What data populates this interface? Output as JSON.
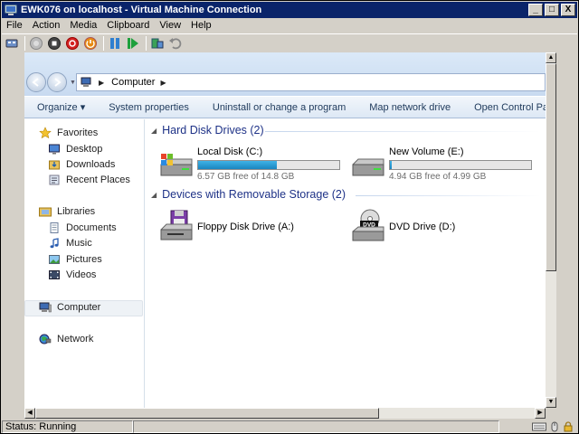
{
  "window": {
    "title": "EWK076 on localhost - Virtual Machine Connection",
    "controls": [
      "_",
      "□",
      "X"
    ]
  },
  "menu": [
    "File",
    "Action",
    "Media",
    "Clipboard",
    "View",
    "Help"
  ],
  "toolbar_icons": [
    "ctrl-alt-del-icon",
    "start-icon",
    "turn-off-icon",
    "shutdown-icon",
    "save-state-icon",
    "pause-icon",
    "reset-icon",
    "snapshot-icon",
    "revert-icon"
  ],
  "explorer": {
    "breadcrumb": "Computer",
    "commands": [
      "Organize ▾",
      "System properties",
      "Uninstall or change a program",
      "Map network drive",
      "Open Control Panel"
    ],
    "nav": {
      "favorites": "Favorites",
      "desktop": "Desktop",
      "downloads": "Downloads",
      "recent": "Recent Places",
      "libraries": "Libraries",
      "documents": "Documents",
      "music": "Music",
      "pictures": "Pictures",
      "videos": "Videos",
      "computer": "Computer",
      "network": "Network"
    },
    "hard_disk_header": "Hard Disk Drives (2)",
    "removable_header": "Devices with Removable Storage (2)",
    "drives": {
      "c": {
        "name": "Local Disk (C:)",
        "free": "6.57 GB free of 14.8 GB",
        "used_fraction": 0.556
      },
      "e": {
        "name": "New Volume (E:)",
        "free": "4.94 GB free of 4.99 GB",
        "used_fraction": 0.01
      },
      "a": {
        "name": "Floppy Disk Drive (A:)"
      },
      "d": {
        "name": "DVD Drive (D:)",
        "badge": "DVD"
      }
    }
  },
  "status": {
    "text": "Status: Running"
  },
  "colors": {
    "titlebar": "#0a246a",
    "progress": "#2a9bd5",
    "link": "#1e3287"
  }
}
